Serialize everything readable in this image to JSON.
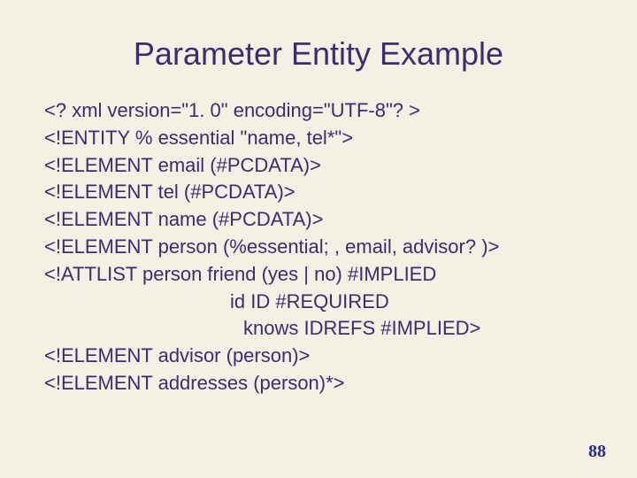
{
  "title": "Parameter Entity Example",
  "lines": {
    "l1": "<? xml version=\"1. 0\" encoding=\"UTF-8\"? >",
    "l2": "<!ENTITY % essential \"name, tel*\">",
    "l3": "<!ELEMENT email (#PCDATA)>",
    "l4": "<!ELEMENT tel (#PCDATA)>",
    "l5": "<!ELEMENT name (#PCDATA)>",
    "l6": "<!ELEMENT person (%essential; , email, advisor? )>",
    "l7": "<!ATTLIST person friend (yes | no) #IMPLIED",
    "l8": "id ID #REQUIRED",
    "l9": "knows IDREFS #IMPLIED>",
    "l10": "<!ELEMENT advisor (person)>",
    "l11": "<!ELEMENT addresses (person)*>"
  },
  "page_number": "88"
}
